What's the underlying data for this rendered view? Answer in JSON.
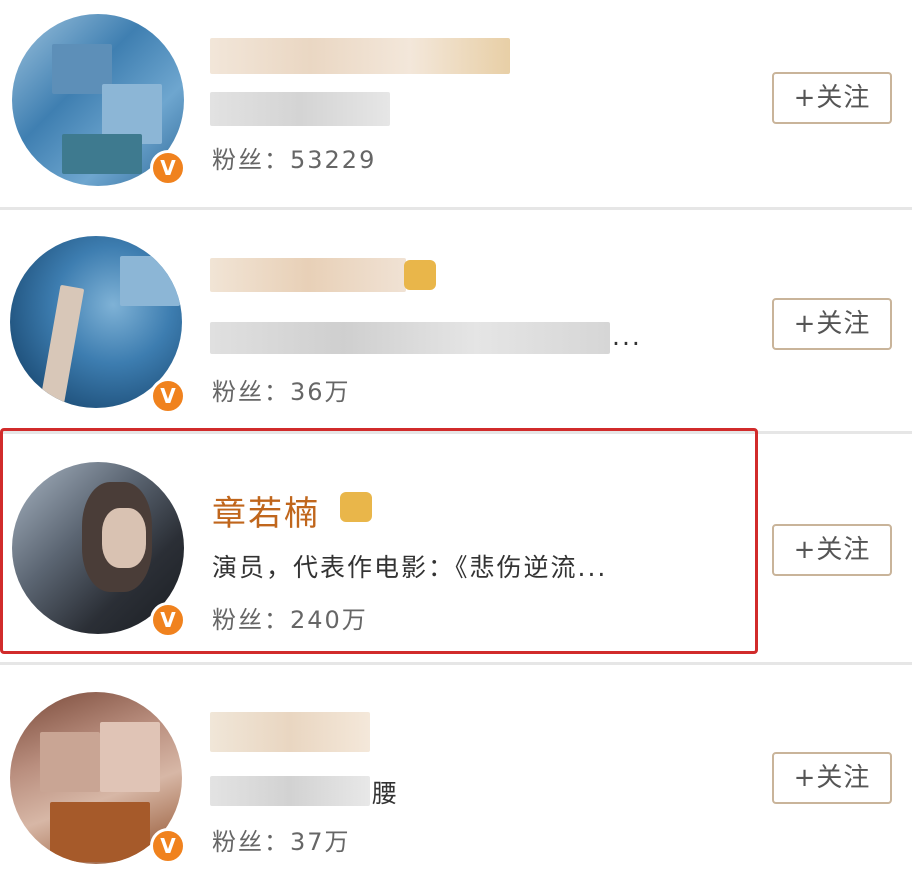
{
  "users": [
    {
      "fans_label": "粉丝：",
      "fans_count": "53229",
      "follow_label": "+关注",
      "verified_mark": "V"
    },
    {
      "fans_label": "粉丝：",
      "fans_count": "36万",
      "follow_label": "+关注",
      "verified_mark": "V",
      "desc_tail": "..."
    },
    {
      "name": "章若楠",
      "description": "演员，代表作电影：《悲伤逆流...",
      "fans_label": "粉丝：",
      "fans_count": "240万",
      "follow_label": "+关注",
      "verified_mark": "V"
    },
    {
      "fans_label": "粉丝：",
      "fans_count": "37万",
      "follow_label": "+关注",
      "verified_mark": "V",
      "desc_tail": "腰"
    }
  ],
  "colors": {
    "highlight_border": "#d12b2b",
    "name_color": "#c0661c",
    "verified_badge": "#f0821e",
    "button_border": "#c9b49a"
  },
  "icons": [
    "crown-icon",
    "verified-icon",
    "plus-icon"
  ]
}
